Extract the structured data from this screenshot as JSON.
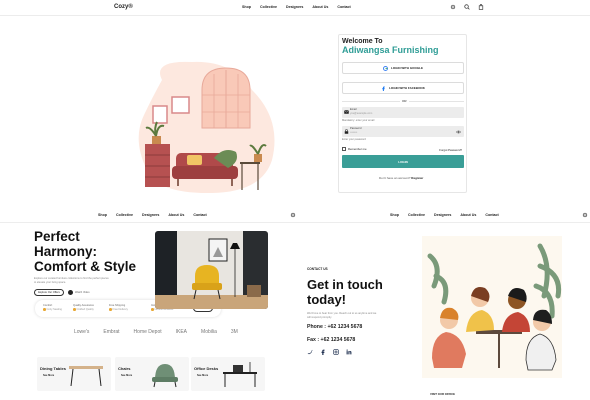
{
  "brand": "Cozy®",
  "nav": [
    "Shop",
    "Collective",
    "Designers",
    "About Us",
    "Contact"
  ],
  "login": {
    "welcome": "Welcome To",
    "brand_name": "Adiwangsa Furnishing",
    "google_label": "LOGIN WITH GOOGLE",
    "facebook_label": "LOGIN WITH FACEBOOK",
    "or_label": "OR",
    "email_label": "Email",
    "email_value": "you@example.com",
    "email_help": "Mandatory: enter your email",
    "password_label": "Password",
    "password_value": "••••••••",
    "password_help": "Enter your password",
    "remember_label": "Remember me",
    "forgot_label": "Forgot Password?",
    "login_button": "LOGIN",
    "signup_prefix": "Don't have an account?",
    "signup_link": "Register"
  },
  "hero": {
    "headline_lines": [
      "Perfect",
      "Harmony:",
      "Comfort & Style"
    ],
    "description": "Explore our curated furniture collections to find the perfect pieces to elevate your living space.",
    "explore_label": "Explore Our Offers",
    "watch_label": "Watch Video",
    "features": [
      {
        "title": "Comfort",
        "sub": "Cozy Seating"
      },
      {
        "title": "Quality Assurance",
        "sub": "Crafted Quality"
      },
      {
        "title": "Free Shipping",
        "sub": "Free Delivery"
      },
      {
        "title": "Instant Feedback",
        "sub": "Honest Reviews"
      }
    ],
    "feedback_label": "Feedback"
  },
  "brands": [
    "Lowe's",
    "Embrat",
    "Home Depot",
    "IKEA",
    "Mobilia",
    "3M"
  ],
  "categories": [
    {
      "name": "Dining Tables",
      "more": "See More"
    },
    {
      "name": "Chairs",
      "more": "See More"
    },
    {
      "name": "Office Desks",
      "more": "See More"
    }
  ],
  "contact": {
    "label": "CONTACT US",
    "headline_lines": [
      "Get in touch",
      "today!"
    ],
    "description": "We'd love to hear from you. Reach out to us anytime and we will respond promptly.",
    "phone": "Phone : +62 1234 5678",
    "fax": "Fax : +62 1234 5678",
    "visit": "VISIT OUR OFFICE"
  },
  "colors": {
    "accent": "#3a9e97",
    "brand_text": "#2f9d96",
    "sofa": "#b04a4a",
    "chair": "#e7b422"
  },
  "icons": [
    "settings-icon",
    "search-icon",
    "cart-icon",
    "google-icon",
    "facebook-icon",
    "mail-icon",
    "lock-icon",
    "eye-icon",
    "play-icon",
    "twitter-icon",
    "facebook-icon",
    "instagram-icon",
    "linkedin-icon"
  ]
}
